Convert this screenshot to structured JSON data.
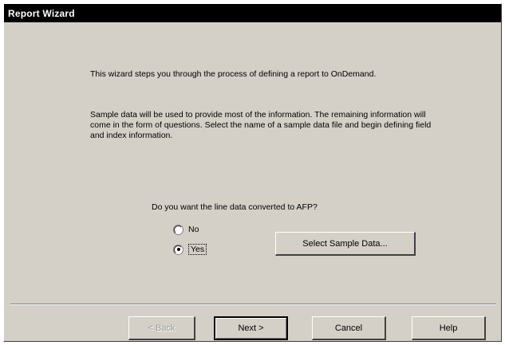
{
  "window": {
    "title": "Report Wizard"
  },
  "intro": {
    "paragraph1": "This wizard steps you through the process of defining a report to OnDemand.",
    "paragraph2": "Sample data will be used to provide most of the information.  The remaining information will come in the form of questions.  Select the name of a sample data file and begin defining field and index information."
  },
  "question": {
    "text": "Do you want the line data converted to AFP?",
    "options": [
      {
        "label": "No",
        "selected": false
      },
      {
        "label": "Yes",
        "selected": true
      }
    ]
  },
  "buttons": {
    "select_sample": "Select Sample Data...",
    "back": "< Back",
    "next": "Next >",
    "cancel": "Cancel",
    "help": "Help"
  }
}
